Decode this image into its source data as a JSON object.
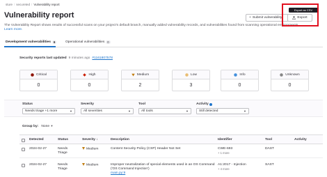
{
  "breadcrumb": {
    "items": [
      "sture",
      "secureted"
    ],
    "current": "Vulnerability report"
  },
  "page": {
    "title": "Vulnerability report",
    "description": "The Vulnerability Report shows results of successful scans on your project's default branch, manually added vulnerability records, and vulnerabilities found from scanning operational environments.",
    "learn_more": "Learn more."
  },
  "header_actions": {
    "submit_label": "Submit vulnerability",
    "export_label": "Export",
    "export_tooltip": "Export as CSV"
  },
  "tabs": [
    {
      "label": "Development vulnerabilities",
      "count": "6",
      "active": true
    },
    {
      "label": "Operational vulnerabilities",
      "count": "0",
      "active": false
    }
  ],
  "last_updated": {
    "label": "Security reports last updated",
    "ago": "9 minutes ago",
    "pipeline": "#1161807578"
  },
  "severity_counts": [
    {
      "label": "Critical",
      "count": "0",
      "color": "#8d1300",
      "shape": "circle"
    },
    {
      "label": "High",
      "count": "0",
      "color": "#c91c00",
      "shape": "diamond"
    },
    {
      "label": "Medium",
      "count": "2",
      "color": "#c17d10",
      "shape": "triangle"
    },
    {
      "label": "Low",
      "count": "3",
      "color": "#e9be74",
      "shape": "circle"
    },
    {
      "label": "Info",
      "count": "0",
      "color": "#428fdc",
      "shape": "circle"
    },
    {
      "label": "Unknown",
      "count": "0",
      "color": "#868686",
      "shape": "circle"
    }
  ],
  "filters": {
    "status": {
      "label": "Status",
      "value": "Needs triage +1 more"
    },
    "severity": {
      "label": "Severity",
      "value": "All severities"
    },
    "tool": {
      "label": "Tool",
      "value": "All tools"
    },
    "activity": {
      "label": "Activity",
      "value": "Still detected"
    }
  },
  "group_by": {
    "label": "Group by:",
    "value": "None"
  },
  "table": {
    "headers": [
      "Detected",
      "Status",
      "Severity",
      "Description",
      "Identifier",
      "Tool",
      "Activity"
    ],
    "rows": [
      {
        "detected": "2024-02-27",
        "status": "Needs Triage",
        "severity": "Medium",
        "description": "Content Security Policy (CSP) Header Not Set",
        "location": "",
        "identifier": "CWE-693",
        "identifier_more": "+ 1 more",
        "tool": "DAST"
      },
      {
        "detected": "2024-02-27",
        "status": "Needs Triage",
        "severity": "Medium",
        "description": "Improper neutralization of special elements used in an OS Command ('OS Command Injection')",
        "location": "main.py:9",
        "identifier": "A1:2017 - Injection",
        "identifier_more": "+ 4 more",
        "tool": "SAST"
      }
    ]
  },
  "colors": {
    "accent": "#1f75cb",
    "highlight": "#e1111f",
    "medium": "#c17d10"
  }
}
